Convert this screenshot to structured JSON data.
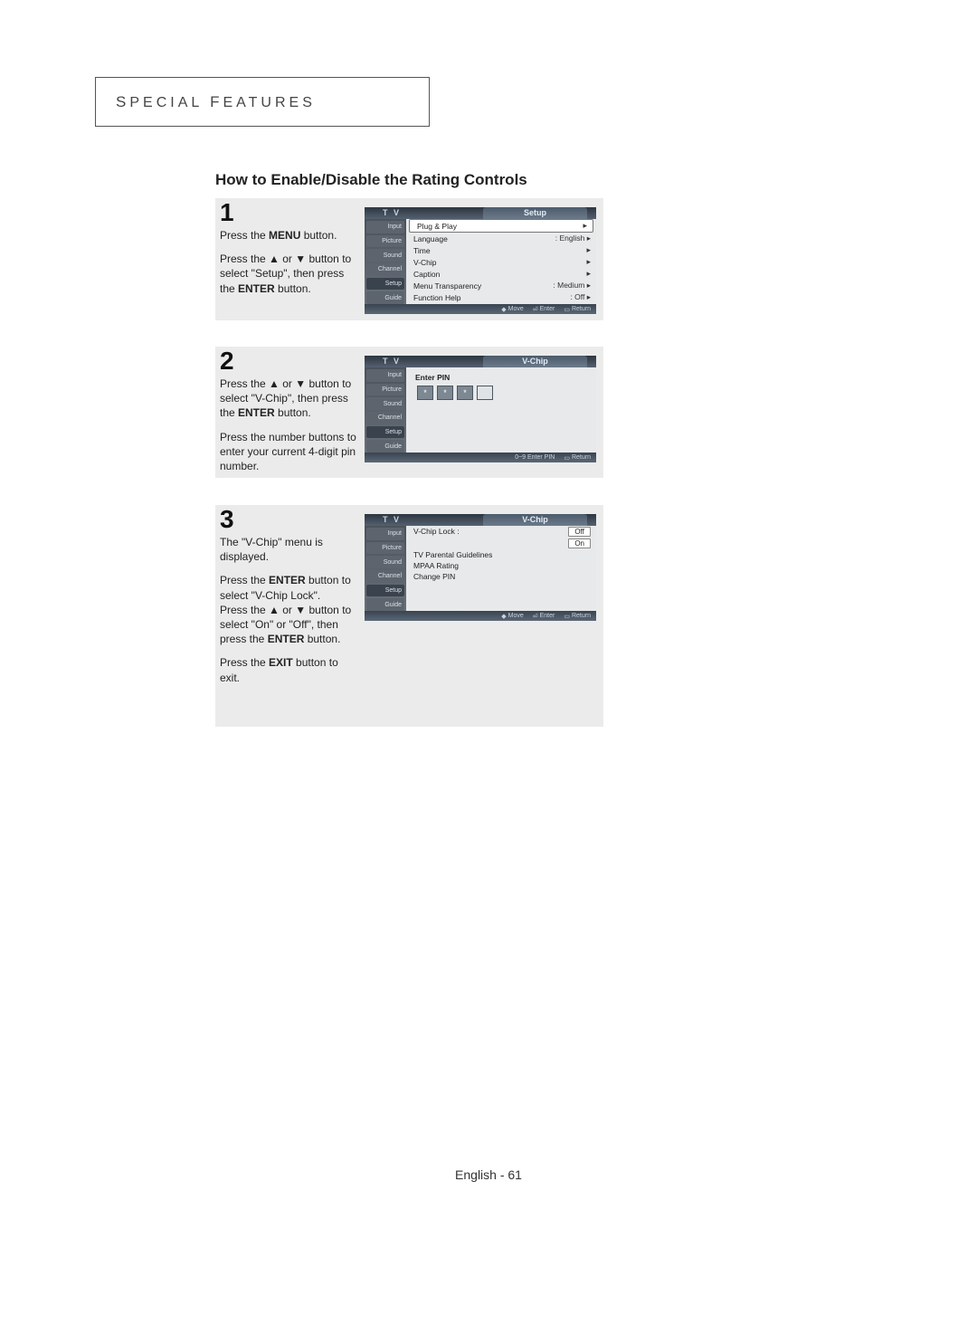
{
  "header": {
    "label": "SPECIAL FEATURES"
  },
  "section_title": "How to Enable/Disable the Rating Controls",
  "steps": {
    "s1": {
      "num": "1",
      "p1a": "Press the ",
      "p1b": "MENU",
      "p1c": " button.",
      "p2a": "Press the ",
      "p2b": " or ",
      "p2c": " button to select \"Setup\", then press the ",
      "p2d": "ENTER",
      "p2e": " button."
    },
    "s2": {
      "num": "2",
      "p1a": "Press the ",
      "p1b": " or ",
      "p1c": " button to select \"V-Chip\", then press the ",
      "p1d": "ENTER",
      "p1e": " button.",
      "p2": "Press the number buttons to enter your current 4-digit pin number."
    },
    "s3": {
      "num": "3",
      "p1": "The \"V-Chip\" menu is displayed.",
      "p2a": "Press the ",
      "p2b": "ENTER",
      "p2c": " button to select \"V-Chip Lock\".",
      "p3a": "Press the ",
      "p3b": " or ",
      "p3c": " button to select \"On\" or \"Off\", then press the ",
      "p3d": "ENTER",
      "p3e": " button.",
      "p4a": "Press the ",
      "p4b": "EXIT",
      "p4c": " button to exit."
    }
  },
  "tv": {
    "tv_label": "T V",
    "side": [
      "Input",
      "Picture",
      "Sound",
      "Channel",
      "Setup",
      "Guide"
    ],
    "screen1": {
      "tab": "Setup",
      "rows": [
        {
          "label": "Plug & Play",
          "val": "",
          "sel": true
        },
        {
          "label": "Language",
          "val": ": English"
        },
        {
          "label": "Time",
          "val": ""
        },
        {
          "label": "V-Chip",
          "val": ""
        },
        {
          "label": "Caption",
          "val": ""
        },
        {
          "label": "Menu Transparency",
          "val": ": Medium"
        },
        {
          "label": "Function Help",
          "val": ": Off"
        }
      ],
      "foot": [
        "Move",
        "Enter",
        "Return"
      ]
    },
    "screen2": {
      "tab": "V-Chip",
      "enter_pin_label": "Enter PIN",
      "pins": [
        "*",
        "*",
        "*",
        ""
      ],
      "foot": [
        "0~9 Enter PIN",
        "Return"
      ]
    },
    "screen3": {
      "tab": "V-Chip",
      "rows": [
        {
          "label": "V-Chip Lock",
          "val": ":",
          "opts": [
            "Off",
            "On"
          ]
        },
        {
          "label": "TV Parental Guidelines",
          "val": ""
        },
        {
          "label": "MPAA Rating",
          "val": ""
        },
        {
          "label": "Change PIN",
          "val": ""
        }
      ],
      "foot": [
        "Move",
        "Enter",
        "Return"
      ]
    }
  },
  "footer": "English - 61"
}
